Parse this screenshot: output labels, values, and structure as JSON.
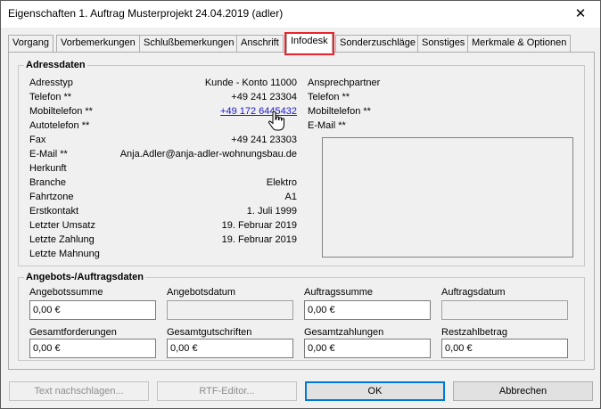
{
  "window": {
    "title": "Eigenschaften 1. Auftrag Musterprojekt 24.04.2019 (adler)",
    "close_glyph": "✕"
  },
  "tabs": [
    {
      "label": "Vorgang"
    },
    {
      "label": "Vorbemerkungen"
    },
    {
      "label": "Schlußbemerkungen"
    },
    {
      "label": "Anschrift"
    },
    {
      "label": "Infodesk"
    },
    {
      "label": "Sonderzuschläge"
    },
    {
      "label": "Sonstiges"
    },
    {
      "label": "Merkmale & Optionen"
    }
  ],
  "address": {
    "legend": "Adressdaten",
    "rows": [
      {
        "label": "Adresstyp",
        "value": "Kunde - Konto 11000"
      },
      {
        "label": "Telefon **",
        "value": "+49 241 23304"
      },
      {
        "label": "Mobiltelefon **",
        "value": "+49 172 6445432"
      },
      {
        "label": "Autotelefon **",
        "value": ""
      },
      {
        "label": "Fax",
        "value": "+49 241 23303"
      },
      {
        "label": "E-Mail **",
        "value": "Anja.Adler@anja-adler-wohnungsbau.de"
      },
      {
        "label": "Herkunft",
        "value": ""
      },
      {
        "label": "Branche",
        "value": "Elektro"
      },
      {
        "label": "Fahrtzone",
        "value": "A1"
      },
      {
        "label": "Erstkontakt",
        "value": "1. Juli 1999"
      },
      {
        "label": "Letzter Umsatz",
        "value": "19. Februar 2019"
      },
      {
        "label": "Letzte Zahlung",
        "value": "19. Februar 2019"
      },
      {
        "label": "Letzte Mahnung",
        "value": ""
      }
    ],
    "contact": {
      "title": "Ansprechpartner",
      "telefon": "Telefon **",
      "mobil": "Mobiltelefon **",
      "email": "E-Mail **"
    }
  },
  "offer": {
    "legend": "Angebots-/Auftragsdaten",
    "fields": [
      {
        "label": "Angebotssumme",
        "value": "0,00 €",
        "enabled": true
      },
      {
        "label": "Angebotsdatum",
        "value": "",
        "enabled": false
      },
      {
        "label": "Auftragssumme",
        "value": "0,00 €",
        "enabled": true
      },
      {
        "label": "Auftragsdatum",
        "value": "",
        "enabled": false
      },
      {
        "label": "Gesamtforderungen",
        "value": "0,00 €",
        "enabled": true
      },
      {
        "label": "Gesamtgutschriften",
        "value": "0,00 €",
        "enabled": true
      },
      {
        "label": "Gesamtzahlungen",
        "value": "0,00 €",
        "enabled": true
      },
      {
        "label": "Restzahlbetrag",
        "value": "0,00 €",
        "enabled": true
      }
    ]
  },
  "buttons": {
    "text_lookup": "Text nachschlagen...",
    "rtf_editor": "RTF-Editor...",
    "ok": "OK",
    "cancel": "Abbrechen"
  },
  "colors": {
    "highlight": "#e8242c",
    "link": "#1a1acc"
  }
}
